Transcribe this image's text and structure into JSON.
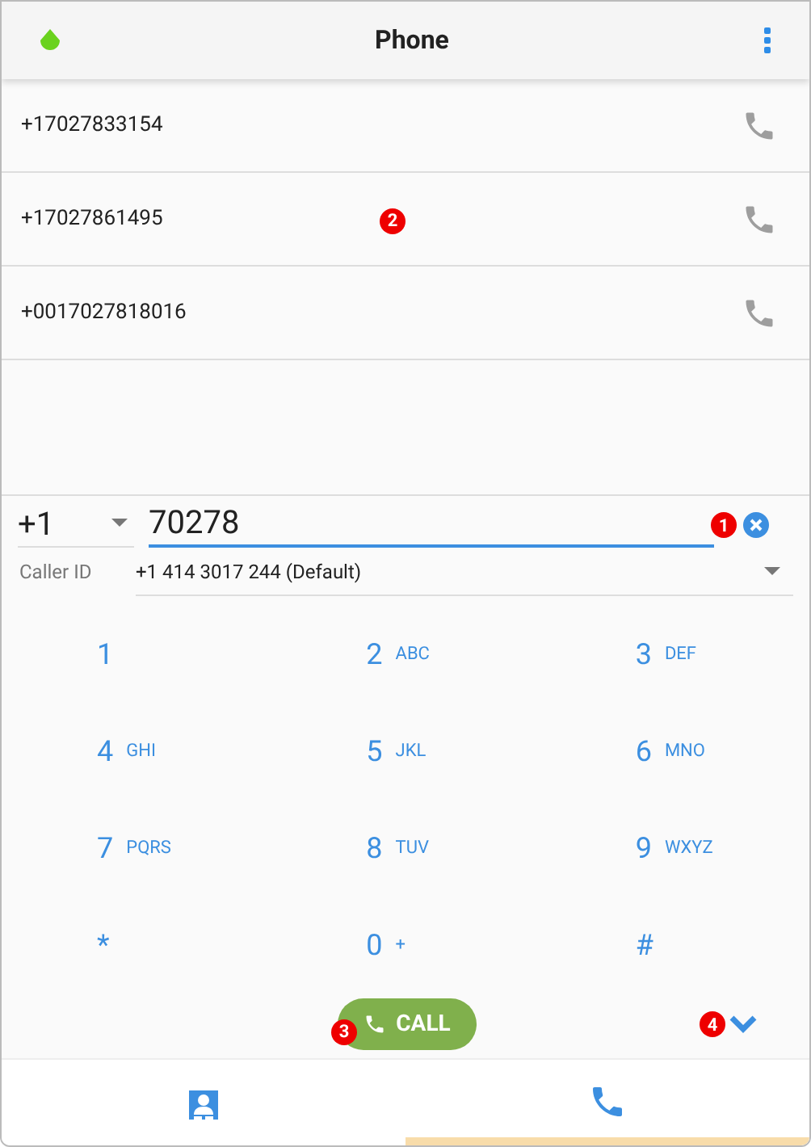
{
  "header": {
    "title": "Phone"
  },
  "recent_numbers": [
    {
      "number": "+17027833154"
    },
    {
      "number": "+17027861495",
      "badge": "2"
    },
    {
      "number": "+0017027818016"
    }
  ],
  "dialer": {
    "country_code": "+1",
    "value": "70278",
    "badge": "1"
  },
  "caller_id": {
    "label": "Caller ID",
    "value": "+1 414 3017 244 (Default)"
  },
  "keypad": [
    {
      "digit": "1"
    },
    {
      "digit": "2",
      "letters": "ABC"
    },
    {
      "digit": "3",
      "letters": "DEF"
    },
    {
      "digit": "4",
      "letters": "GHI"
    },
    {
      "digit": "5",
      "letters": "JKL"
    },
    {
      "digit": "6",
      "letters": "MNO"
    },
    {
      "digit": "7",
      "letters": "PQRS"
    },
    {
      "digit": "8",
      "letters": "TUV"
    },
    {
      "digit": "9",
      "letters": "WXYZ"
    },
    {
      "digit": "*"
    },
    {
      "digit": "0",
      "letters": "+"
    },
    {
      "digit": "#"
    }
  ],
  "call_button": {
    "label": "CALL",
    "badge": "3"
  },
  "collapse": {
    "badge": "4"
  },
  "nav_tabs": [
    {
      "kind": "contacts",
      "selected": false
    },
    {
      "kind": "phone",
      "selected": true
    }
  ]
}
